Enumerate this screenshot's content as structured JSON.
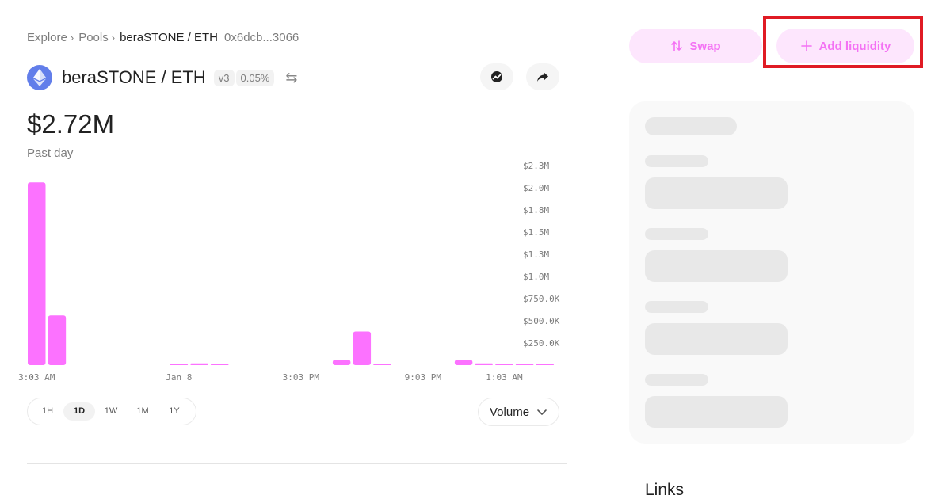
{
  "breadcrumb": {
    "explore": "Explore",
    "pools": "Pools",
    "current": "beraSTONE / ETH",
    "address": "0x6dcb...3066"
  },
  "pool": {
    "title": "beraSTONE / ETH",
    "version": "v3",
    "fee": "0.05%"
  },
  "stats": {
    "value": "$2.72M",
    "period": "Past day"
  },
  "chart_data": {
    "type": "bar",
    "y_ticks": [
      "$2.3M",
      "$2.0M",
      "$1.8M",
      "$1.5M",
      "$1.3M",
      "$1.0M",
      "$750.0K",
      "$500.0K",
      "$250.0K"
    ],
    "y_tick_values": [
      2250000,
      2000000,
      1750000,
      1500000,
      1250000,
      1000000,
      750000,
      500000,
      250000
    ],
    "ylim": [
      0,
      2500000
    ],
    "x_ticks": [
      {
        "label": "3:03 AM",
        "index": 0
      },
      {
        "label": "Jan 8",
        "index": 7
      },
      {
        "label": "3:03 PM",
        "index": 13
      },
      {
        "label": "9:03 PM",
        "index": 19
      },
      {
        "label": "1:03 AM",
        "index": 23
      }
    ],
    "values": [
      2060000,
      560000,
      0,
      0,
      0,
      0,
      0,
      10000,
      20000,
      10000,
      0,
      0,
      0,
      0,
      0,
      60000,
      380000,
      8000,
      0,
      0,
      0,
      60000,
      20000,
      6000,
      6000,
      6000
    ],
    "bar_color": "#fc72ff",
    "grid": false
  },
  "time_ranges": [
    {
      "label": "1H",
      "active": false
    },
    {
      "label": "1D",
      "active": true
    },
    {
      "label": "1W",
      "active": false
    },
    {
      "label": "1M",
      "active": false
    },
    {
      "label": "1Y",
      "active": false
    }
  ],
  "chart_type_select": {
    "value": "Volume"
  },
  "actions": {
    "swap_label": "Swap",
    "add_liquidity_label": "Add liquidity"
  },
  "links": {
    "title": "Links"
  },
  "colors": {
    "accent": "#fc72ff",
    "accent_soft": "#fde6fd",
    "highlight": "#e01b24",
    "eth_blue": "#627eea"
  }
}
